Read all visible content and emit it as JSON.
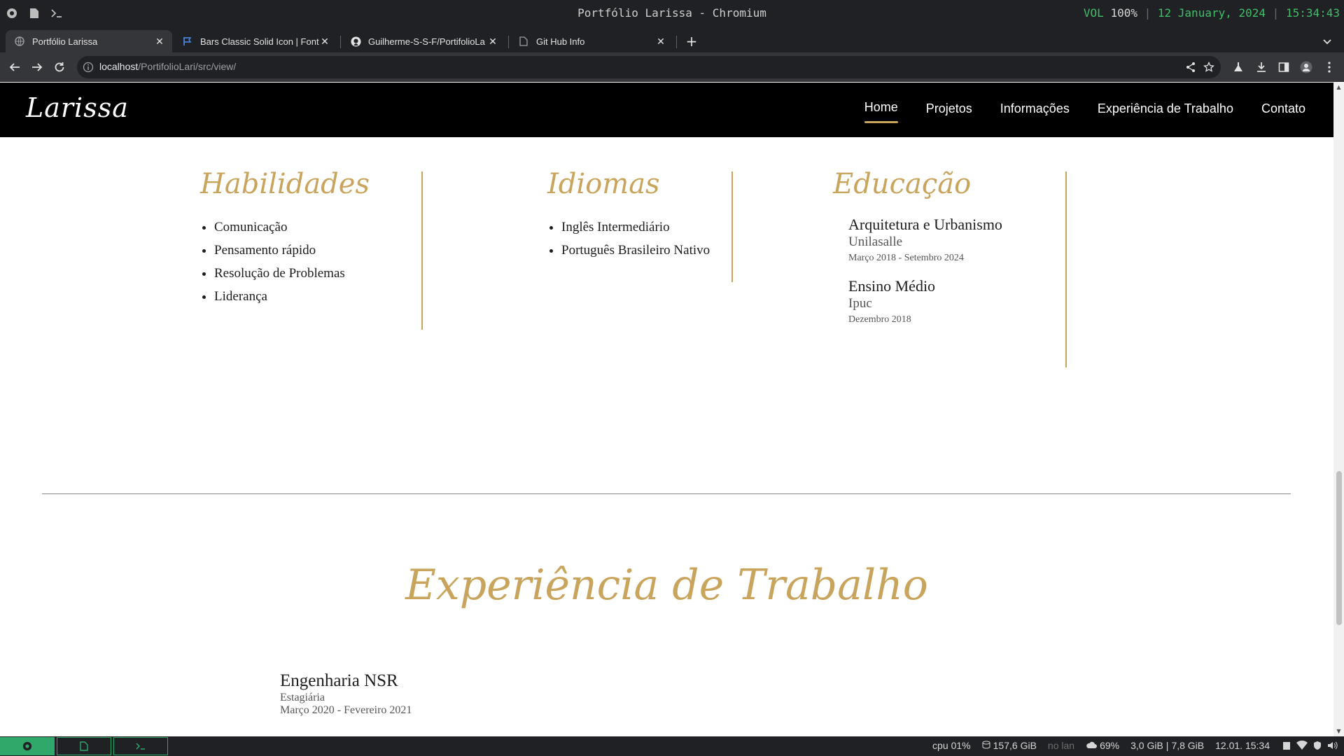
{
  "window": {
    "title": "Portfólio Larissa - Chromium",
    "status": {
      "vol_label": "VOL",
      "vol_value": "100%",
      "separator": "|",
      "date": "12 January, 2024",
      "time": "15:34:43"
    }
  },
  "tabs": [
    {
      "label": "Portfólio Larissa",
      "icon": "globe-icon",
      "active": true
    },
    {
      "label": "Bars Classic Solid Icon | Font",
      "icon": "flag-icon",
      "active": false
    },
    {
      "label": "Guilherme-S-S-F/PortifolioLa",
      "icon": "github-icon",
      "active": false
    },
    {
      "label": "Git Hub Info",
      "icon": "document-icon",
      "active": false
    }
  ],
  "omnibox": {
    "host": "localhost",
    "path": "/PortifolioLari/src/view/"
  },
  "site": {
    "brand": "Larissa",
    "nav": [
      "Home",
      "Projetos",
      "Informações",
      "Experiência de Trabalho",
      "Contato"
    ],
    "active_nav": "Home",
    "skills": {
      "heading": "Habilidades",
      "items": [
        "Comunicação",
        "Pensamento rápido",
        "Resolução de Problemas",
        "Liderança"
      ]
    },
    "languages": {
      "heading": "Idiomas",
      "items": [
        "Inglês Intermediário",
        "Português Brasileiro Nativo"
      ]
    },
    "education": {
      "heading": "Educação",
      "items": [
        {
          "title": "Arquitetura e Urbanismo",
          "school": "Unilasalle",
          "dates": "Março 2018 - Setembro 2024"
        },
        {
          "title": "Ensino Médio",
          "school": "Ipuc",
          "dates": "Dezembro 2018"
        }
      ]
    },
    "experience": {
      "heading": "Experiência de Trabalho",
      "jobs": [
        {
          "company": "Engenharia NSR",
          "role": "Estagiária",
          "dates": "Março 2020 - Fevereiro 2021"
        }
      ]
    }
  },
  "panel": {
    "cpu_label": "cpu",
    "cpu_value": "01%",
    "disk": "157,6 GiB",
    "lan": "no lan",
    "battery": "69%",
    "mem_used": "3,0 GiB",
    "mem_total": "7,8 GiB",
    "clock": "12.01. 15:34"
  },
  "colors": {
    "accent_gold": "#c9a45c",
    "nav_bg": "#000000",
    "panel_green": "#2fa86a"
  }
}
